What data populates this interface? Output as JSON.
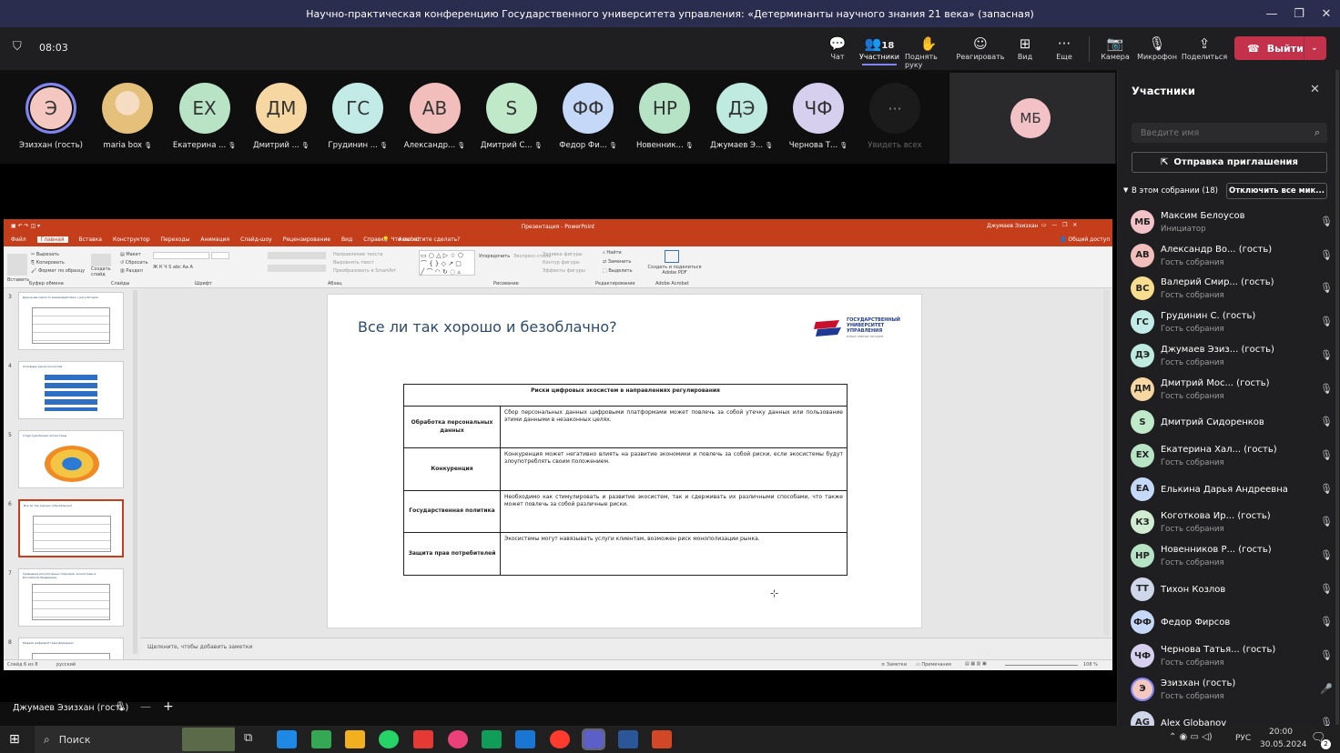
{
  "window": {
    "title": "Научно-практическая конференцию Государственного университета управления: «Детерминанты научного знания 21 века» (запасная)"
  },
  "meeting": {
    "timer": "08:03"
  },
  "toolbar": {
    "chat": "Чат",
    "participants": "Участники",
    "participants_count": "18",
    "raise_hand": "Поднять руку",
    "react": "Реагировать",
    "view": "Вид",
    "more": "Еще",
    "camera": "Камера",
    "mic": "Микрофон",
    "share": "Поделиться",
    "leave": "Выйти"
  },
  "video_tiles": [
    {
      "initials": "Э",
      "name": "Эзизхан (гость)",
      "color": "#f4c8c0"
    },
    {
      "initials": "",
      "name": "maria box",
      "color": "#d9b27c"
    },
    {
      "initials": "ЕХ",
      "name": "Екатерина ...",
      "color": "#b8e3c4"
    },
    {
      "initials": "ДМ",
      "name": "Дмитрий ...",
      "color": "#f7d7a1"
    },
    {
      "initials": "ГС",
      "name": "Грудинин ...",
      "color": "#c2ebe7"
    },
    {
      "initials": "АВ",
      "name": "Александр...",
      "color": "#f1bebb"
    },
    {
      "initials": "S",
      "name": "Дмитрий С...",
      "color": "#bfe9c8"
    },
    {
      "initials": "ФФ",
      "name": "Федор Фи...",
      "color": "#c6d8f7"
    },
    {
      "initials": "НР",
      "name": "Новенник...",
      "color": "#b6e2c6"
    },
    {
      "initials": "ДЭ",
      "name": "Джумаев Э...",
      "color": "#bfeadf"
    },
    {
      "initials": "ЧФ",
      "name": "Чернова Т...",
      "color": "#d6d0ee"
    }
  ],
  "see_all": "Увидеть всех",
  "mb_tile": {
    "initials": "МБ",
    "color": "#f2c2c7"
  },
  "ppt": {
    "app_title": "Презентация - PowerPoint",
    "user": "Джумаев Эзизхан",
    "tabs": [
      "Файл",
      "Главная",
      "Вставка",
      "Конструктор",
      "Переходы",
      "Анимация",
      "Слайд-шоу",
      "Рецензирование",
      "Вид",
      "Справка",
      "Acrobat"
    ],
    "search_hint": "Что вы хотите сделать?",
    "share": "Общий доступ",
    "ribbon": {
      "paste": "Вставить",
      "cut": "Вырезать",
      "copy": "Копировать",
      "format_painter": "Формат по образцу",
      "clipboard": "Буфер обмена",
      "new_slide": "Создать слайд",
      "layout": "Макет",
      "reset": "Сбросить",
      "section": "Раздел",
      "slides": "Слайды",
      "font": "Шрифт",
      "paragraph": "Абзац",
      "text_direction": "Направление текста",
      "align_text": "Выровнять текст",
      "convert_smartart": "Преобразовать в SmartArt",
      "arrange": "Упорядочить",
      "quick_styles": "Экспресс-стили",
      "shape_fill": "Заливка фигуры",
      "shape_outline": "Контур фигуры",
      "shape_effects": "Эффекты фигуры",
      "drawing": "Рисование",
      "find": "Найти",
      "replace": "Заменить",
      "select": "Выделить",
      "editing": "Редактирование",
      "acrobat_btn": "Создать и поделиться Adobe PDF",
      "adobe_acrobat": "Adobe Acrobat"
    },
    "thumb_numbers": [
      "3",
      "4",
      "5",
      "6",
      "7",
      "8"
    ],
    "thumb_titles": [
      "Дорожная карта по взаимодействию с регулятором",
      "Основные риски экосистем",
      "Структура бизнес-экосистемы",
      "Все ли так хорошо и безоблачно?",
      "Сравнение регуляторных подходов: экосистемы в Российской Федерации",
      "Модели цифровой трансформации"
    ],
    "notes": "Щелкните, чтобы добавить заметки",
    "status_slide": "Слайд 6 из 8",
    "status_lang": "русский",
    "status_notes": "Заметки",
    "status_comments": "Примечания",
    "zoom": "108 %",
    "slide": {
      "title": "Все ли так хорошо и безоблачно?",
      "logo_text": "ГОСУДАРСТВЕННЫЙ УНИВЕРСИТЕТ УПРАВЛЕНИЯ",
      "logo_sub": "вчера завтра сегодня",
      "table_header": "Риски цифровых экосистем в направлениях регулирования",
      "rows": [
        {
          "label": "Обработка персональных данных",
          "text": "Сбор персональных данных цифровыми платформами может повлечь за собой утечку данных или пользование этими данными в незаконных целях."
        },
        {
          "label": "Конкуренция",
          "text": "Конкуренция может негативно влиять на развитие экономики и повлечь за собой риски, если экосистемы будут злоупотреблять своим положением."
        },
        {
          "label": "Государственная политика",
          "text": "Необходимо как стимулировать и развитие экосистем, так и сдерживать их различными способами, что также может повлечь за собой различные риски."
        },
        {
          "label": "Защита прав потребителей",
          "text": "Экосистемы могут навязывать услуги клиентам, возможен риск монополизации рынка."
        }
      ]
    }
  },
  "bottom": {
    "presenter": "Джумаев Эзизхан (гость)"
  },
  "panel": {
    "title": "Участники",
    "search_placeholder": "Введите имя",
    "invite": "Отправка приглашения",
    "section": "В этом собрании (18)",
    "mute_all": "Отключить все мик...",
    "people": [
      {
        "initials": "МБ",
        "name": "Максим Белоусов",
        "role": "Инициатор",
        "color": "#f2c2c7"
      },
      {
        "initials": "АВ",
        "name": "Александр Во... (гость)",
        "role": "Гость собрания",
        "color": "#f1bebb"
      },
      {
        "initials": "ВС",
        "name": "Валерий Смир... (гость)",
        "role": "Гость собрания",
        "color": "#f7dd8f"
      },
      {
        "initials": "ГС",
        "name": "Грудинин С. (гость)",
        "role": "Гость собрания",
        "color": "#c2ebe7"
      },
      {
        "initials": "ДЭ",
        "name": "Джумаев Эзиз... (гость)",
        "role": "Гость собрания",
        "color": "#bfeadf"
      },
      {
        "initials": "ДМ",
        "name": "Дмитрий Мос... (гость)",
        "role": "Гость собрания",
        "color": "#f7d7a1"
      },
      {
        "initials": "S",
        "name": "Дмитрий Сидоренков",
        "role": "",
        "color": "#bfe9c8"
      },
      {
        "initials": "ЕХ",
        "name": "Екатерина Хал... (гость)",
        "role": "Гость собрания",
        "color": "#b8e3c4"
      },
      {
        "initials": "ЕА",
        "name": "Елькина Дарья Андреевна",
        "role": "",
        "color": "#c6d8f7"
      },
      {
        "initials": "КЗ",
        "name": "Коготкова Ир... (гость)",
        "role": "Гость собрания",
        "color": "#d2ecd2"
      },
      {
        "initials": "НР",
        "name": "Новенников Р... (гость)",
        "role": "Гость собрания",
        "color": "#b6e2c6"
      },
      {
        "initials": "ТТ",
        "name": "Тихон Козлов",
        "role": "",
        "color": "#cfd6ea"
      },
      {
        "initials": "ФФ",
        "name": "Федор Фирсов",
        "role": "",
        "color": "#c6d8f7"
      },
      {
        "initials": "ЧФ",
        "name": "Чернова Татья... (гость)",
        "role": "Гость собрания",
        "color": "#d6d0ee"
      },
      {
        "initials": "Э",
        "name": "Эзизхан (гость)",
        "role": "Гость собрания",
        "color": "#f4c8c0"
      },
      {
        "initials": "AG",
        "name": "Alex Globanov",
        "role": "",
        "color": "#cfd6ea"
      }
    ]
  },
  "taskbar": {
    "search": "Поиск",
    "lang": "РУС",
    "time": "20:00",
    "date": "30.05.2024",
    "notif": "2"
  }
}
